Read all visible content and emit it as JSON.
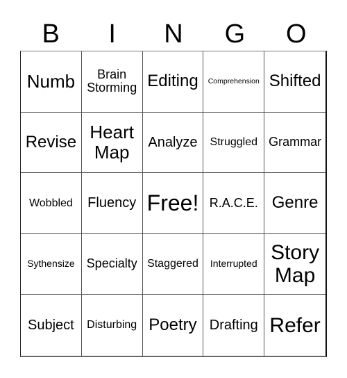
{
  "header": {
    "letters": [
      "B",
      "I",
      "N",
      "G",
      "O"
    ]
  },
  "cells": [
    {
      "text": "Numb",
      "size": "s-l"
    },
    {
      "text": "Brain Storming",
      "size": "s-sm"
    },
    {
      "text": "Editing",
      "size": "s-ml"
    },
    {
      "text": "Comprehension",
      "size": "s-xxs"
    },
    {
      "text": "Shifted",
      "size": "s-ml"
    },
    {
      "text": "Revise",
      "size": "s-ml"
    },
    {
      "text": "Heart Map",
      "size": "s-l"
    },
    {
      "text": "Analyze",
      "size": "s-m"
    },
    {
      "text": "Struggled",
      "size": "s-s"
    },
    {
      "text": "Grammar",
      "size": "s-sm"
    },
    {
      "text": "Wobbled",
      "size": "s-s"
    },
    {
      "text": "Fluency",
      "size": "s-m"
    },
    {
      "text": "Free!",
      "size": "free"
    },
    {
      "text": "R.A.C.E.",
      "size": "s-sm"
    },
    {
      "text": "Genre",
      "size": "s-ml"
    },
    {
      "text": "Sythensize",
      "size": "s-xs"
    },
    {
      "text": "Specialty",
      "size": "s-sm"
    },
    {
      "text": "Staggered",
      "size": "s-s"
    },
    {
      "text": "Interrupted",
      "size": "s-xs"
    },
    {
      "text": "Story Map",
      "size": "s-xl"
    },
    {
      "text": "Subject",
      "size": "s-m"
    },
    {
      "text": "Disturbing",
      "size": "s-s"
    },
    {
      "text": "Poetry",
      "size": "s-ml"
    },
    {
      "text": "Drafting",
      "size": "s-m"
    },
    {
      "text": "Refer",
      "size": "s-xl"
    }
  ]
}
